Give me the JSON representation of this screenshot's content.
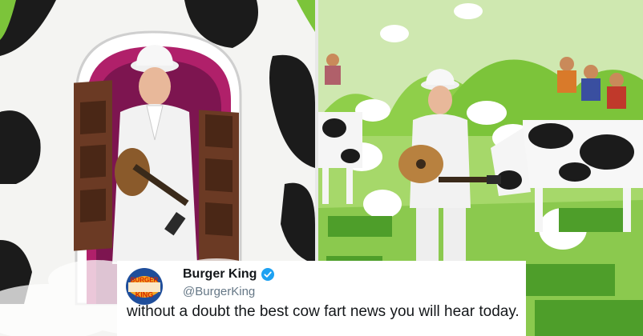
{
  "tweet": {
    "account_name": "Burger King",
    "handle": "@BurgerKing",
    "text": "without a doubt the best cow fart news you will hear today.",
    "verified": true,
    "logo_text_top": "BURGER",
    "logo_text_bottom": "KING"
  },
  "colors": {
    "verified_badge": "#1da1f2",
    "logo_bun": "#f5a623",
    "logo_text": "#d62300",
    "logo_ring": "#1f4e9b",
    "scene_green": "#7cc43a",
    "barn_magenta": "#b0206a"
  }
}
